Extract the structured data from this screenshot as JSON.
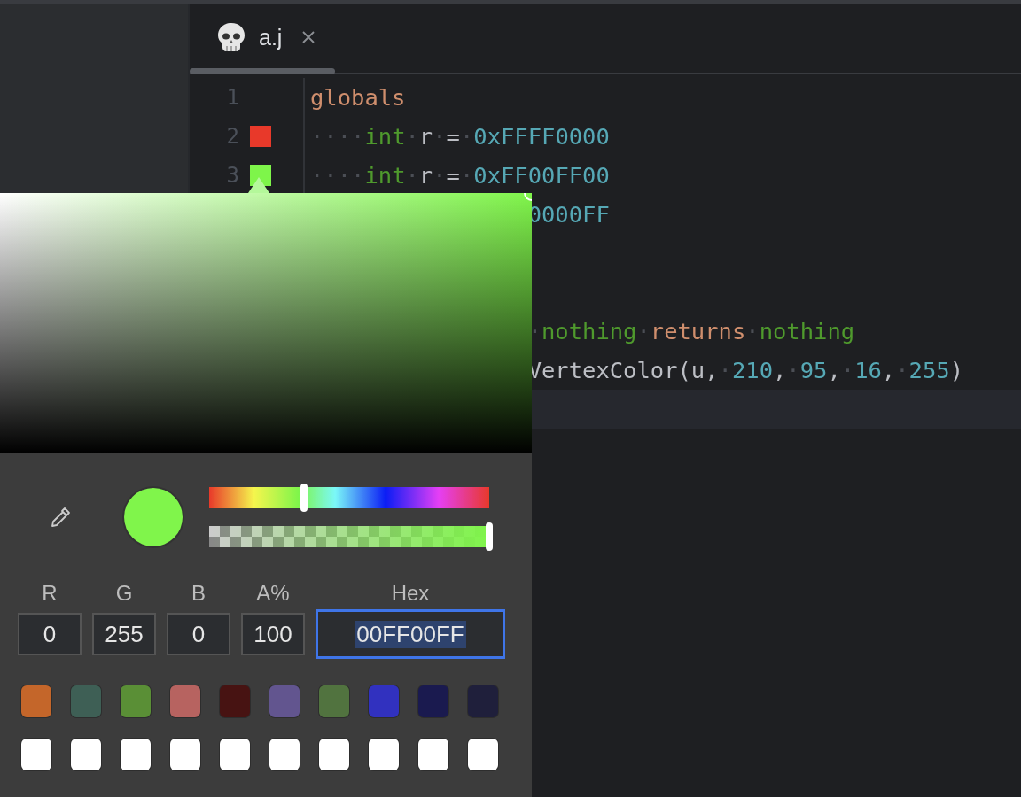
{
  "tab": {
    "title": "a.j"
  },
  "editor": {
    "lines": [
      {
        "number": "1",
        "tokens": [
          {
            "kind": "keyword",
            "text": "globals"
          }
        ]
      },
      {
        "number": "2",
        "swatch": {
          "color": "#e8392a"
        },
        "tokens": [
          {
            "kind": "ws",
            "text": "····"
          },
          {
            "kind": "type",
            "text": "int"
          },
          {
            "kind": "ws",
            "text": "·"
          },
          {
            "kind": "plain",
            "text": "r"
          },
          {
            "kind": "ws",
            "text": "·"
          },
          {
            "kind": "plain",
            "text": "="
          },
          {
            "kind": "ws",
            "text": "·"
          },
          {
            "kind": "number",
            "text": "0xFFFF0000"
          }
        ]
      },
      {
        "number": "3",
        "swatch": {
          "color": "#7ef54a"
        },
        "tokens": [
          {
            "kind": "ws",
            "text": "····"
          },
          {
            "kind": "type",
            "text": "int"
          },
          {
            "kind": "ws",
            "text": "·"
          },
          {
            "kind": "plain",
            "text": "r"
          },
          {
            "kind": "ws",
            "text": "·"
          },
          {
            "kind": "plain",
            "text": "="
          },
          {
            "kind": "ws",
            "text": "·"
          },
          {
            "kind": "number",
            "text": "0xFF00FF00"
          }
        ]
      },
      {
        "clipped": true,
        "tokens": [
          {
            "kind": "number",
            "text": "0000FF"
          }
        ]
      },
      {
        "clipped": true
      },
      {
        "clipped": true
      },
      {
        "clipped": true,
        "tokens": [
          {
            "kind": "ws",
            "text": "·"
          },
          {
            "kind": "type",
            "text": "nothing"
          },
          {
            "kind": "ws",
            "text": "·"
          },
          {
            "kind": "keyword",
            "text": "returns"
          },
          {
            "kind": "ws",
            "text": "·"
          },
          {
            "kind": "type",
            "text": "nothing"
          }
        ]
      },
      {
        "clipped": true,
        "tokens": [
          {
            "kind": "plain",
            "text": "VertexColor(u,"
          },
          {
            "kind": "ws",
            "text": "·"
          },
          {
            "kind": "number",
            "text": "210"
          },
          {
            "kind": "plain",
            "text": ","
          },
          {
            "kind": "ws",
            "text": "·"
          },
          {
            "kind": "number",
            "text": "95"
          },
          {
            "kind": "plain",
            "text": ","
          },
          {
            "kind": "ws",
            "text": "·"
          },
          {
            "kind": "number",
            "text": "16"
          },
          {
            "kind": "plain",
            "text": ","
          },
          {
            "kind": "ws",
            "text": "·"
          },
          {
            "kind": "number",
            "text": "255"
          },
          {
            "kind": "plain",
            "text": ")"
          }
        ]
      },
      {
        "clipped": true,
        "current": true
      }
    ]
  },
  "color_picker": {
    "preview": {
      "color": "#80f54b"
    },
    "hue": {
      "level": 0.34
    },
    "alpha": {
      "level": 1
    },
    "fields": [
      {
        "label": "R",
        "value": "0",
        "focused": false,
        "text_selected": false
      },
      {
        "label": "G",
        "value": "255",
        "focused": false,
        "text_selected": false
      },
      {
        "label": "B",
        "value": "0",
        "focused": false,
        "text_selected": false
      },
      {
        "label": "A%",
        "value": "100",
        "focused": false,
        "text_selected": false
      },
      {
        "label": "Hex",
        "value": "00FF00FF",
        "focused": true,
        "text_selected": true
      }
    ],
    "recent_colors": [
      {
        "color": "#c4662a"
      },
      {
        "color": "#3e5f55"
      },
      {
        "color": "#5a8f36"
      },
      {
        "color": "#b76360"
      },
      {
        "color": "#471312"
      },
      {
        "color": "#62558f"
      },
      {
        "color": "#51733f"
      },
      {
        "color": "#3131bf"
      },
      {
        "color": "#1a1a4f"
      },
      {
        "color": "#1f1f3b"
      }
    ],
    "saved_colors": [
      {
        "color": "#ffffff"
      },
      {
        "color": "#ffffff"
      },
      {
        "color": "#ffffff"
      },
      {
        "color": "#ffffff"
      },
      {
        "color": "#ffffff"
      },
      {
        "color": "#ffffff"
      },
      {
        "color": "#ffffff"
      },
      {
        "color": "#ffffff"
      },
      {
        "color": "#ffffff"
      },
      {
        "color": "#ffffff"
      }
    ]
  }
}
